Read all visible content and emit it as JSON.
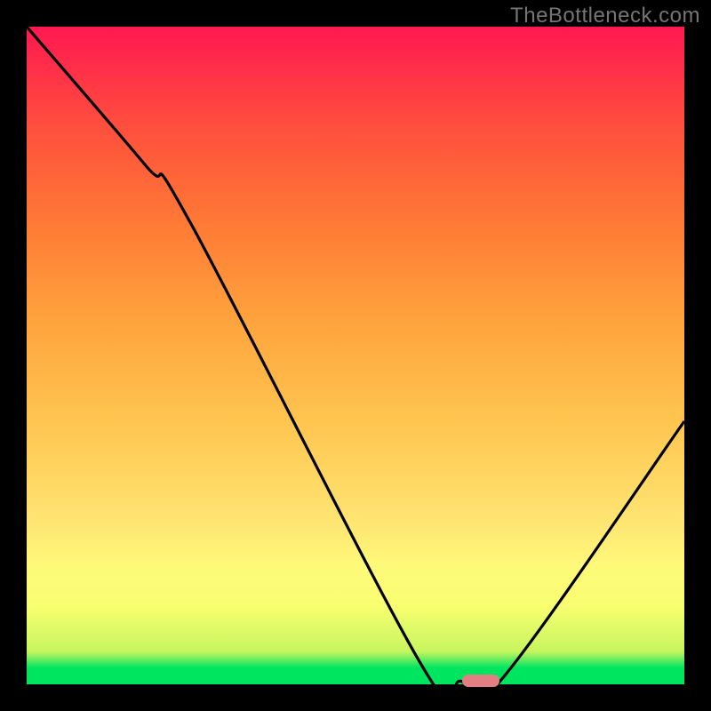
{
  "watermark": "TheBottleneck.com",
  "colors": {
    "frame": "#000000",
    "curve": "#000000",
    "marker": "#e37f82",
    "gradient_top": "#ff1850",
    "gradient_mid": "#ffe472",
    "gradient_bottom": "#00e560"
  },
  "chart_data": {
    "type": "line",
    "title": "",
    "xlabel": "",
    "ylabel": "",
    "xlim": [
      0,
      100
    ],
    "ylim": [
      0,
      100
    ],
    "series": [
      {
        "name": "bottleneck-curve",
        "x": [
          0,
          18,
          25,
          60,
          66,
          72,
          100
        ],
        "values": [
          100,
          79,
          70,
          3,
          0.5,
          0.5,
          40
        ]
      }
    ],
    "annotations": [
      {
        "name": "optimal-range-marker",
        "x": 69,
        "y": 0.5,
        "shape": "pill",
        "color": "#e37f82"
      }
    ]
  }
}
